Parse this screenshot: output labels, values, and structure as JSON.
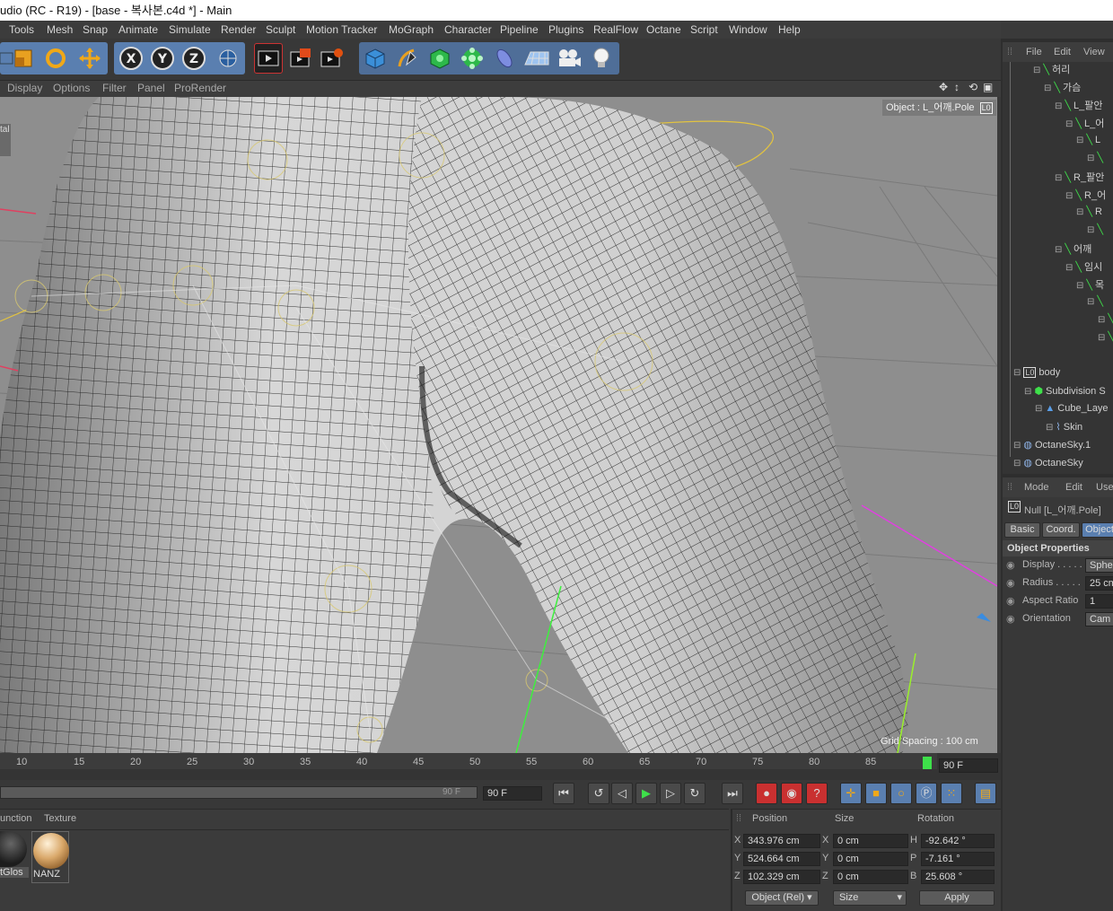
{
  "window": {
    "title": "udio (RC - R19) - [base - 복사본.c4d *] - Main"
  },
  "menu": [
    "Tools",
    "Mesh",
    "Snap",
    "Animate",
    "Simulate",
    "Render",
    "Sculpt",
    "Motion Tracker",
    "MoGraph",
    "Character",
    "Pipeline",
    "Plugins",
    "RealFlow",
    "Octane",
    "Script",
    "Window",
    "Help"
  ],
  "toolbar": {
    "axis_x": "X",
    "axis_y": "Y",
    "axis_z": "Z",
    "icons": [
      "move-icon",
      "scale-icon",
      "rotate-icon",
      "world-axis-icon",
      "render-view-icon",
      "render-picture-queue-icon",
      "render-settings-icon",
      "cube-primitive-icon",
      "pen-spline-icon",
      "subdivision-icon",
      "cloner-icon",
      "deformer-icon",
      "floor-icon",
      "camera-icon",
      "light-icon"
    ]
  },
  "viewport_menu": [
    "Display",
    "Options",
    "Filter",
    "Panel",
    "ProRender"
  ],
  "viewport": {
    "object_label": "Object : L_어깨.Pole",
    "grid_spacing": "Grid Spacing : 100 cm",
    "left_edge_label": "tal"
  },
  "timeline": {
    "ticks": [
      "10",
      "15",
      "20",
      "25",
      "30",
      "35",
      "40",
      "45",
      "50",
      "55",
      "60",
      "65",
      "70",
      "75",
      "80",
      "85"
    ],
    "end_frame": "90 F",
    "current_max": "90 F",
    "current_end": "90 F"
  },
  "materials": {
    "tabs": [
      "unction",
      "Texture"
    ],
    "items": [
      {
        "name": "tGlos",
        "color": "#2b2b2b"
      },
      {
        "name": "NANZ",
        "color": "#d9a86a"
      }
    ]
  },
  "coords": {
    "headers": {
      "position": "Position",
      "size": "Size",
      "rotation": "Rotation"
    },
    "rows": [
      {
        "axis": "X",
        "pos": "343.976 cm",
        "size_axis": "X",
        "size": "0 cm",
        "rot_axis": "H",
        "rot": "-92.642 °"
      },
      {
        "axis": "Y",
        "pos": "524.664 cm",
        "size_axis": "Y",
        "size": "0 cm",
        "rot_axis": "P",
        "rot": "-7.161 °"
      },
      {
        "axis": "Z",
        "pos": "102.329 cm",
        "size_axis": "Z",
        "size": "0 cm",
        "rot_axis": "B",
        "rot": "25.608 °"
      }
    ],
    "mode": "Object (Rel)",
    "size_mode": "Size",
    "apply": "Apply"
  },
  "object_manager": {
    "menu": [
      "File",
      "Edit",
      "View"
    ],
    "items": [
      {
        "label": "허리",
        "indent": 0
      },
      {
        "label": "가슴",
        "indent": 1
      },
      {
        "label": "L_팔안",
        "indent": 2
      },
      {
        "label": "L_어",
        "indent": 3
      },
      {
        "label": "L",
        "indent": 4
      },
      {
        "label": "",
        "indent": 5
      },
      {
        "label": "R_팔안",
        "indent": 2
      },
      {
        "label": "R_어",
        "indent": 3
      },
      {
        "label": "R",
        "indent": 4
      },
      {
        "label": "",
        "indent": 5
      },
      {
        "label": "어깨",
        "indent": 2
      },
      {
        "label": "임시",
        "indent": 3
      },
      {
        "label": "목",
        "indent": 4
      },
      {
        "label": "",
        "indent": 5
      },
      {
        "label": "",
        "indent": 6
      },
      {
        "label": "",
        "indent": 6
      },
      {
        "label": "body",
        "indent": 0
      },
      {
        "label": "Subdivision S",
        "indent": 1
      },
      {
        "label": "Cube_Laye",
        "indent": 2
      },
      {
        "label": "Skin",
        "indent": 3
      },
      {
        "label": "OctaneSky.1",
        "indent": 0
      },
      {
        "label": "OctaneSky",
        "indent": 0
      }
    ]
  },
  "attributes": {
    "menu": [
      "Mode",
      "Edit",
      "Use"
    ],
    "object_title": "Null [L_어깨.Pole]",
    "tabs": [
      "Basic",
      "Coord.",
      "Object"
    ],
    "active_tab": "Object",
    "section": "Object Properties",
    "props": [
      {
        "label": "Display . . . . .",
        "value": "Sphe"
      },
      {
        "label": "Radius . . . . .",
        "value": "25 cm"
      },
      {
        "label": "Aspect Ratio",
        "value": "1"
      },
      {
        "label": "Orientation",
        "value": "Cam"
      }
    ]
  }
}
